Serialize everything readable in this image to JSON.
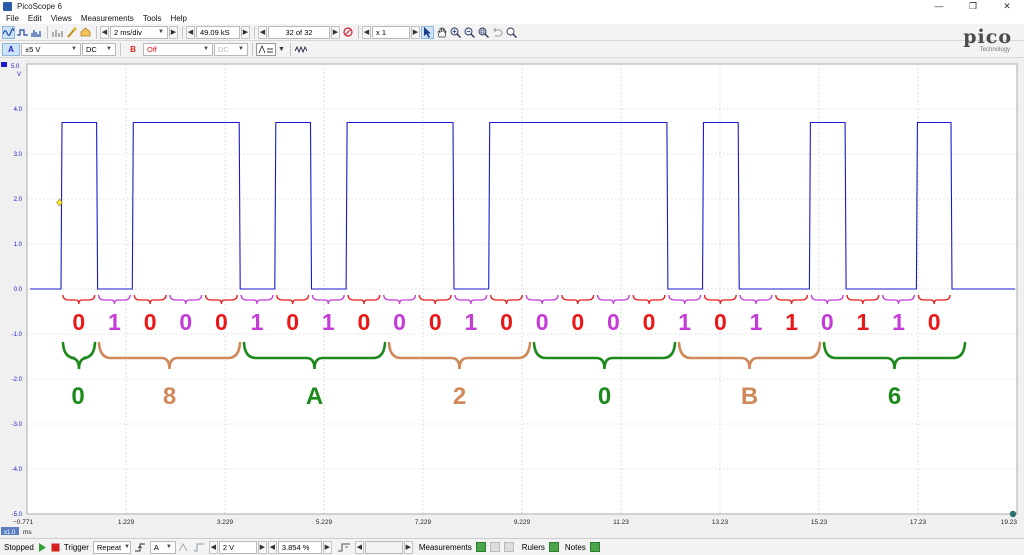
{
  "window": {
    "title": "PicoScope 6",
    "minimize": "—",
    "restore": "❐",
    "close": "✕"
  },
  "menu": [
    "File",
    "Edit",
    "Views",
    "Measurements",
    "Tools",
    "Help"
  ],
  "toolbar1": {
    "timebase": "2 ms/div",
    "samples": "49.09 kS",
    "buffer": "32 of 32",
    "zoom": "x 1"
  },
  "toolbar2": {
    "channel_a": "A",
    "range_a": "±5 V",
    "coupling_a": "DC",
    "channel_b": "B",
    "range_b": "Off",
    "coupling_b": "DC"
  },
  "logo": {
    "word": "pico",
    "tagline": "Technology"
  },
  "scope": {
    "yunit": "V",
    "yticks": [
      "5.0",
      "4.0",
      "3.0",
      "2.0",
      "1.0",
      "0.0",
      "-1.0",
      "-2.0",
      "-3.0",
      "-4.0",
      "-5.0"
    ],
    "xticks": [
      "−0.771",
      "1.229",
      "3.229",
      "5.229",
      "7.229",
      "9.229",
      "11.23",
      "13.23",
      "15.23",
      "17.23",
      "19.23"
    ],
    "xunit": "ms",
    "xscale_label": "x1.0",
    "trace_color": "#1a1acc",
    "grid_color": "#bdbdbd"
  },
  "annotations": {
    "bits": [
      "0",
      "1",
      "0",
      "0",
      "0",
      "1",
      "0",
      "1",
      "0",
      "0",
      "0",
      "1",
      "0",
      "0",
      "0",
      "0",
      "0",
      "1",
      "0",
      "1",
      "1",
      "0",
      "1",
      "1",
      "0"
    ],
    "bit_colors": [
      "#e81818",
      "#c43bd8",
      "#e81818",
      "#c43bd8",
      "#e81818",
      "#c43bd8",
      "#e81818",
      "#c43bd8",
      "#e81818",
      "#c43bd8",
      "#e81818",
      "#c43bd8",
      "#e81818",
      "#c43bd8",
      "#e81818",
      "#c43bd8",
      "#e81818",
      "#c43bd8",
      "#e81818",
      "#c43bd8",
      "#e81818",
      "#c43bd8",
      "#e81818",
      "#c43bd8",
      "#e81818"
    ],
    "nibbles": [
      "0",
      "8",
      "A",
      "2",
      "0",
      "B",
      "6"
    ],
    "nibble_colors": [
      "#1e8a1e",
      "#d0895a",
      "#1e8a1e",
      "#d0895a",
      "#1e8a1e",
      "#d0895a",
      "#1e8a1e"
    ]
  },
  "status": {
    "state": "Stopped",
    "trigger_label": "Trigger",
    "trigger_mode": "Repeat",
    "trigger_channel": "A",
    "trigger_level": "2 V",
    "pretrigger": "3.854 %",
    "measurements": "Measurements",
    "rulers": "Rulers",
    "notes": "Notes"
  }
}
